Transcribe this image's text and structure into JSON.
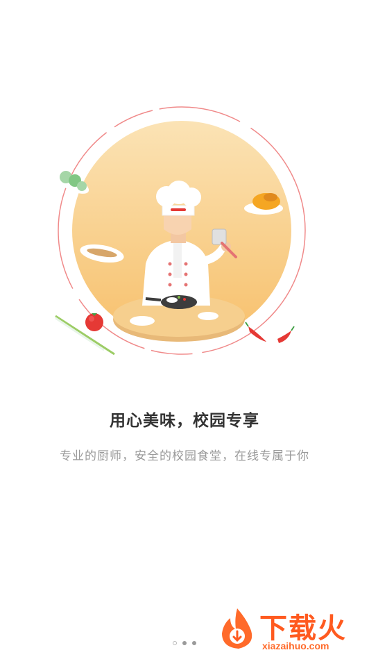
{
  "onboarding": {
    "headline": "用心美味，校园专享",
    "subtitle": "专业的厨师，安全的校园食堂，在线专属于你",
    "page_indicator": {
      "total": 3,
      "active": 1
    }
  },
  "watermark": {
    "brand": "下载火",
    "url": "xiazaihuo.com"
  },
  "colors": {
    "circle": "#f8c978",
    "ring": "#ef7b7b",
    "headline": "#333333",
    "subtitle": "#9a9a9a",
    "watermark": "#ff5a1f"
  }
}
